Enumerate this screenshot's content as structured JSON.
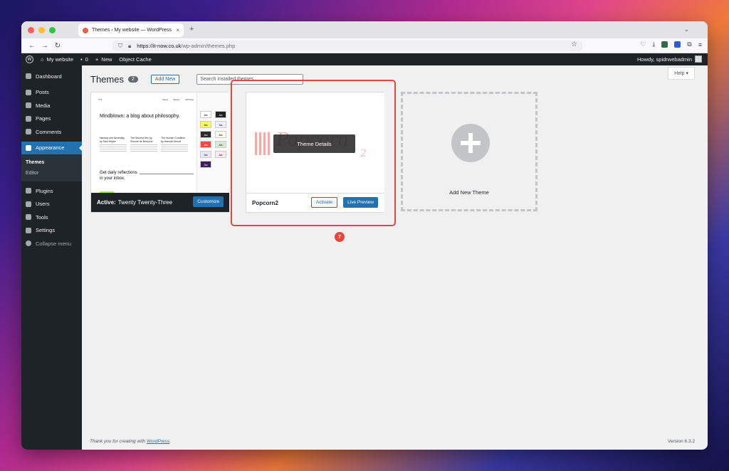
{
  "browser": {
    "tab_title": "Themes ‹ My website — WordPress",
    "tab_close": "×",
    "new_tab": "+",
    "url_host": "https://it-now.co.uk",
    "url_path": "/wp-admin/themes.php"
  },
  "adminbar": {
    "site_name": "My website",
    "comments_count": "0",
    "new_label": "New",
    "object_cache": "Object Cache",
    "howdy": "Howdy, spidrwebadmin"
  },
  "sidebar": {
    "dashboard": "Dashboard",
    "posts": "Posts",
    "media": "Media",
    "pages": "Pages",
    "comments": "Comments",
    "appearance": "Appearance",
    "themes": "Themes",
    "editor": "Editor",
    "plugins": "Plugins",
    "users": "Users",
    "tools": "Tools",
    "settings": "Settings",
    "collapse": "Collapse menu"
  },
  "header": {
    "title": "Themes",
    "count": "2",
    "add_new": "Add New",
    "search_placeholder": "Search installed themes...",
    "help": "Help ▾"
  },
  "themes": {
    "active": {
      "screenshot_headline": "Mindblown: a blog about philosophy.",
      "screenshot_col1": "Naming and Necessity by Saul Kripke",
      "screenshot_col2": "The Second Sex by Simone de Beauvoir",
      "screenshot_col3": "The Human Condition by Hannah Arendt",
      "screenshot_bottom": "Get daily reflections in your inbox.",
      "active_prefix": "Active:",
      "name": "Twenty Twenty-Three",
      "customize": "Customize"
    },
    "popcorn": {
      "name": "Popcorn2",
      "details": "Theme Details",
      "activate": "Activate",
      "live_preview": "Live Preview",
      "art_text": "Popcorn",
      "art_two": "2"
    },
    "add_new_label": "Add New Theme"
  },
  "annotation": {
    "step": "7"
  },
  "footer": {
    "thanks_prefix": "Thank you for creating with ",
    "thanks_link": "WordPress",
    "thanks_suffix": ".",
    "version": "Version 6.3.2"
  }
}
